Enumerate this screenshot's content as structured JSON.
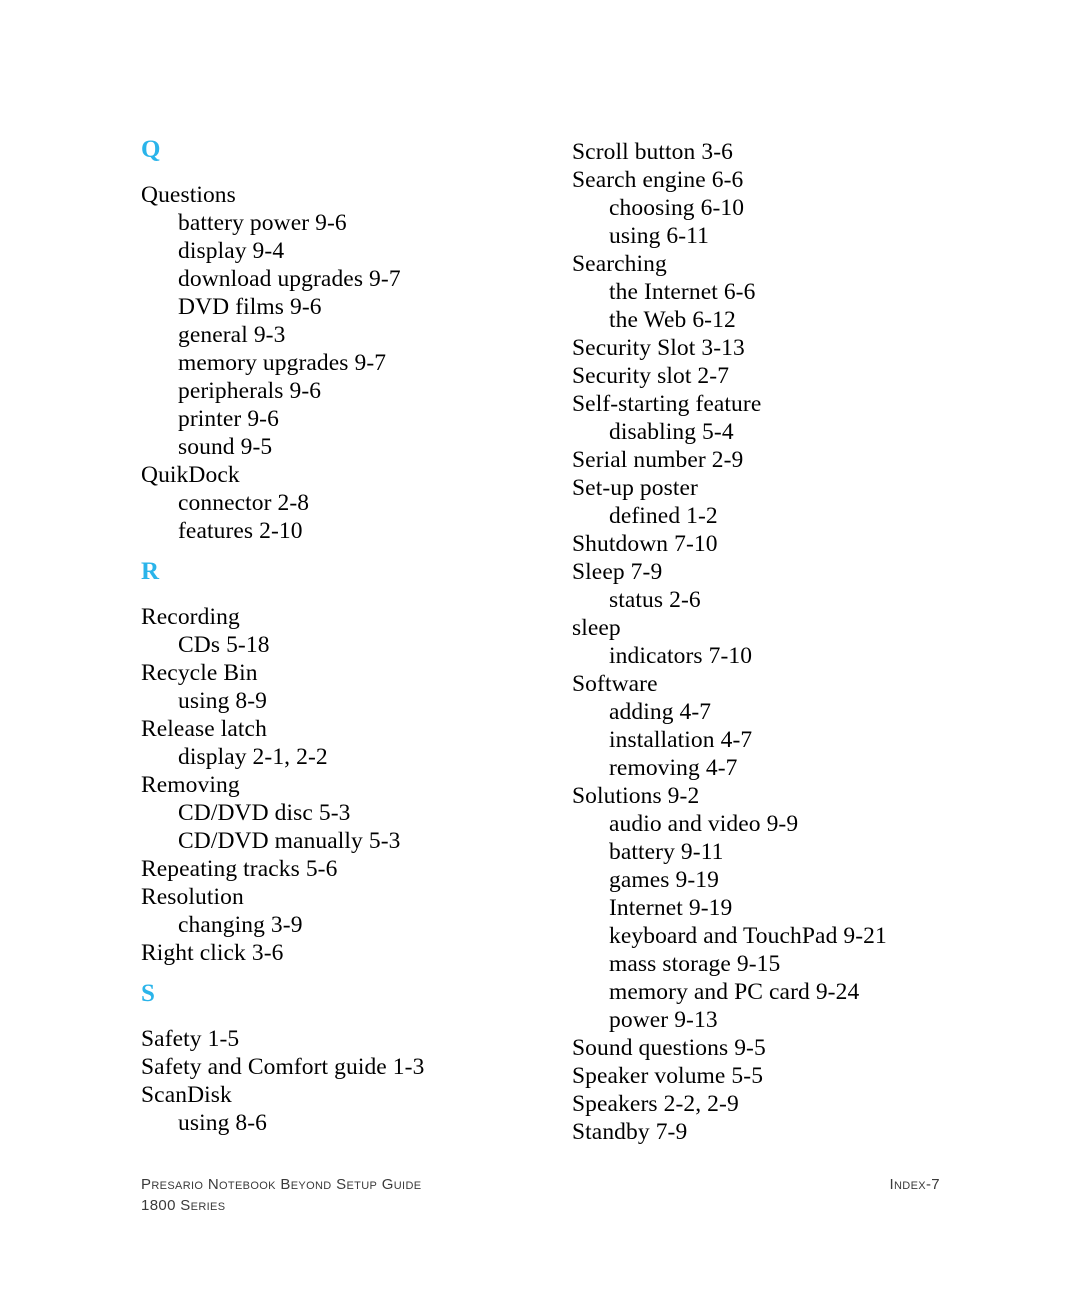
{
  "page": {
    "background_color": "#ffffff",
    "text_color": "#000000",
    "accent_color": "#2ab4ea",
    "footer_color": "#3a3a3a",
    "page_label": "INDEX-7"
  },
  "columns": [
    {
      "id": "left",
      "blocks": [
        {
          "type": "letter",
          "text": "Q"
        },
        {
          "type": "main",
          "text": "Questions"
        },
        {
          "type": "sub",
          "text": "battery power 9-6"
        },
        {
          "type": "sub",
          "text": "display 9-4"
        },
        {
          "type": "sub",
          "text": "download upgrades 9-7"
        },
        {
          "type": "sub",
          "text": "DVD films 9-6"
        },
        {
          "type": "sub",
          "text": "general 9-3"
        },
        {
          "type": "sub",
          "text": "memory upgrades 9-7"
        },
        {
          "type": "sub",
          "text": "peripherals 9-6"
        },
        {
          "type": "sub",
          "text": "printer 9-6"
        },
        {
          "type": "sub",
          "text": "sound 9-5"
        },
        {
          "type": "main",
          "text": "QuikDock"
        },
        {
          "type": "sub",
          "text": "connector 2-8"
        },
        {
          "type": "sub",
          "text": "features 2-10"
        },
        {
          "type": "letter",
          "text": "R"
        },
        {
          "type": "main",
          "text": "Recording"
        },
        {
          "type": "sub",
          "text": "CDs 5-18"
        },
        {
          "type": "main",
          "text": "Recycle Bin"
        },
        {
          "type": "sub",
          "text": "using 8-9"
        },
        {
          "type": "main",
          "text": "Release latch"
        },
        {
          "type": "sub",
          "text": "display 2-1, 2-2"
        },
        {
          "type": "main",
          "text": "Removing"
        },
        {
          "type": "sub",
          "text": "CD/DVD disc 5-3"
        },
        {
          "type": "sub",
          "text": "CD/DVD manually 5-3"
        },
        {
          "type": "main",
          "text": "Repeating tracks 5-6"
        },
        {
          "type": "main",
          "text": "Resolution"
        },
        {
          "type": "sub",
          "text": "changing 3-9"
        },
        {
          "type": "main",
          "text": "Right click 3-6"
        },
        {
          "type": "letter",
          "text": "S"
        },
        {
          "type": "main",
          "text": "Safety 1-5"
        },
        {
          "type": "main",
          "text": "Safety and Comfort guide 1-3"
        },
        {
          "type": "main",
          "text": "ScanDisk"
        },
        {
          "type": "sub",
          "text": "using 8-6"
        }
      ]
    },
    {
      "id": "right",
      "blocks": [
        {
          "type": "main",
          "text": "Scroll button 3-6"
        },
        {
          "type": "main",
          "text": "Search engine 6-6"
        },
        {
          "type": "sub",
          "text": "choosing 6-10"
        },
        {
          "type": "sub",
          "text": "using 6-11"
        },
        {
          "type": "main",
          "text": "Searching"
        },
        {
          "type": "sub",
          "text": "the Internet 6-6"
        },
        {
          "type": "sub",
          "text": "the Web 6-12"
        },
        {
          "type": "main",
          "text": "Security Slot 3-13"
        },
        {
          "type": "main",
          "text": "Security slot 2-7"
        },
        {
          "type": "main",
          "text": "Self-starting feature"
        },
        {
          "type": "sub",
          "text": "disabling 5-4"
        },
        {
          "type": "main",
          "text": "Serial number 2-9"
        },
        {
          "type": "main",
          "text": "Set-up poster"
        },
        {
          "type": "sub",
          "text": "defined 1-2"
        },
        {
          "type": "main",
          "text": "Shutdown 7-10"
        },
        {
          "type": "main",
          "text": "Sleep 7-9"
        },
        {
          "type": "sub",
          "text": "status 2-6"
        },
        {
          "type": "main",
          "text": "sleep"
        },
        {
          "type": "sub",
          "text": "indicators 7-10"
        },
        {
          "type": "main",
          "text": "Software"
        },
        {
          "type": "sub",
          "text": "adding 4-7"
        },
        {
          "type": "sub",
          "text": "installation 4-7"
        },
        {
          "type": "sub",
          "text": "removing 4-7"
        },
        {
          "type": "main",
          "text": "Solutions 9-2"
        },
        {
          "type": "sub",
          "text": "audio and video 9-9"
        },
        {
          "type": "sub",
          "text": "battery 9-11"
        },
        {
          "type": "sub",
          "text": "games 9-19"
        },
        {
          "type": "sub",
          "text": "Internet 9-19"
        },
        {
          "type": "sub",
          "text": "keyboard and TouchPad 9-21"
        },
        {
          "type": "sub",
          "text": "mass storage 9-15"
        },
        {
          "type": "sub",
          "text": "memory and PC card 9-24"
        },
        {
          "type": "sub",
          "text": "power 9-13"
        },
        {
          "type": "main",
          "text": "Sound questions 9-5"
        },
        {
          "type": "main",
          "text": "Speaker volume 5-5"
        },
        {
          "type": "main",
          "text": "Speakers 2-2, 2-9"
        },
        {
          "type": "main",
          "text": "Standby 7-9"
        }
      ]
    }
  ],
  "footer": {
    "line1": "Presario Notebook Beyond Setup Guide",
    "line2": "1800 Series",
    "page_number": "Index-7"
  }
}
